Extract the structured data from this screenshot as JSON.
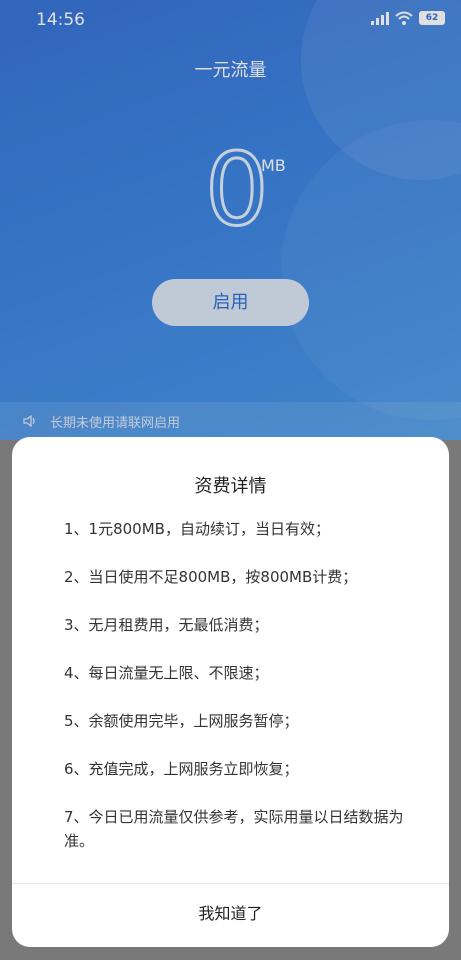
{
  "status_bar": {
    "time": "14:56",
    "battery": "62"
  },
  "header": {
    "title": "一元流量"
  },
  "usage": {
    "value": "0",
    "unit": "MB"
  },
  "enable_button": "启用",
  "notice": "长期未使用请联网启用",
  "dialog": {
    "title": "资费详情",
    "items": [
      "1、1元800MB，自动续订，当日有效；",
      "2、当日使用不足800MB，按800MB计费；",
      "3、无月租费用，无最低消费；",
      "4、每日流量无上限、不限速；",
      "5、余额使用完毕，上网服务暂停；",
      "6、充值完成，上网服务立即恢复；",
      "7、今日已用流量仅供参考，实际用量以日结数据为准。"
    ],
    "confirm": "我知道了"
  }
}
